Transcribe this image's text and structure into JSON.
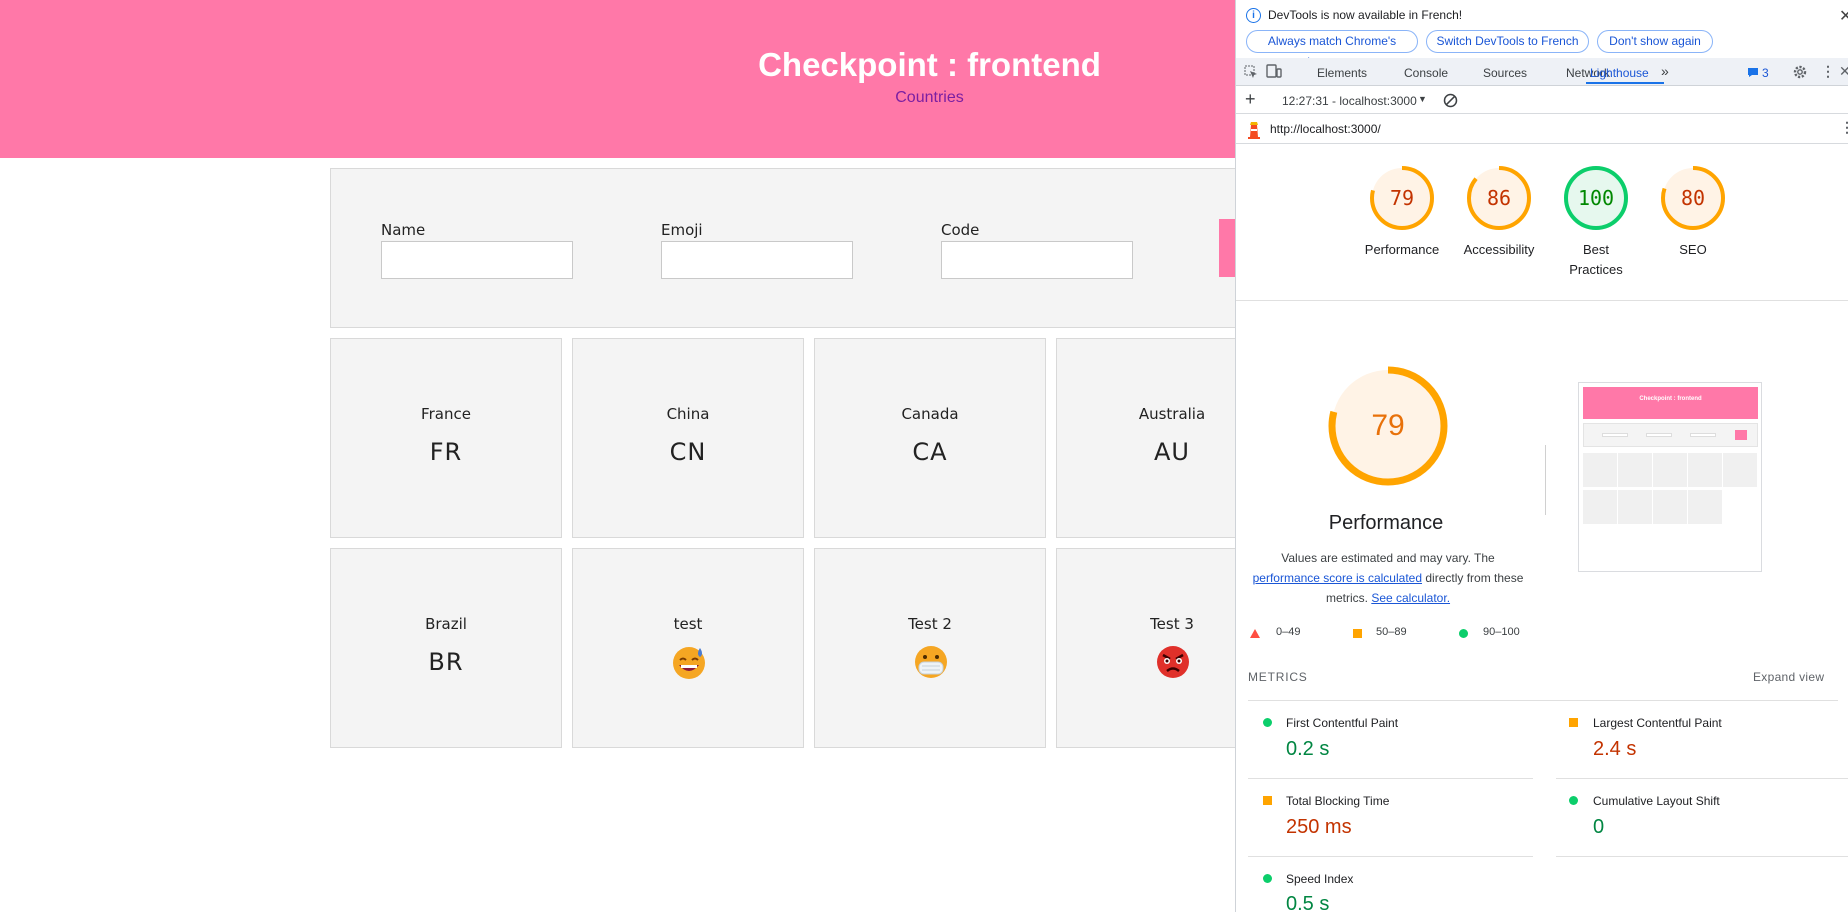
{
  "app": {
    "title": "Checkpoint : frontend",
    "nav_link": "Countries",
    "form": {
      "name_label": "Name",
      "emoji_label": "Emoji",
      "code_label": "Code",
      "name_value": "",
      "emoji_value": "",
      "code_value": ""
    },
    "cards": [
      {
        "name": "France",
        "code": "FR"
      },
      {
        "name": "China",
        "code": "CN"
      },
      {
        "name": "Canada",
        "code": "CA"
      },
      {
        "name": "Australia",
        "code": "AU"
      },
      {
        "name": "Brazil",
        "code": "BR"
      },
      {
        "name": "test",
        "emoji": "grinning-sweat-emoji"
      },
      {
        "name": "Test 2",
        "emoji": "face-with-mask-emoji"
      },
      {
        "name": "Test 3",
        "emoji": "angry-face-emoji"
      }
    ],
    "colors": {
      "header": "#ff78a8",
      "card": "#f4f4f4"
    }
  },
  "devtools": {
    "infobar": {
      "message": "DevTools is now available in French!",
      "buttons": [
        "Always match Chrome's language",
        "Switch DevTools to French",
        "Don't show again"
      ]
    },
    "tabs": [
      "Elements",
      "Console",
      "Sources",
      "Network",
      "Lighthouse"
    ],
    "active_tab": "Lighthouse",
    "issues_count": "3",
    "report_selector": "12:27:31 - localhost:3000",
    "url": "http://localhost:3000/",
    "scores": [
      {
        "label": "Performance",
        "value": 79,
        "color": "#e8710a"
      },
      {
        "label": "Accessibility",
        "value": 86,
        "color": "#e8710a"
      },
      {
        "label": "Best Practices",
        "value": 100,
        "color": "#0cce6b"
      },
      {
        "label": "SEO",
        "value": 80,
        "color": "#e8710a"
      }
    ],
    "performance": {
      "score": 79,
      "title": "Performance",
      "desc_1": "Values are estimated and may vary. The",
      "desc_link_1": "performance score is calculated",
      "desc_2": "directly from these metrics.",
      "desc_link_2": "See calculator."
    },
    "legend": [
      "0–49",
      "50–89",
      "90–100"
    ],
    "metrics_header": "METRICS",
    "expand_view": "Expand view",
    "metrics": [
      {
        "title": "First Contentful Paint",
        "value": "0.2 s",
        "status": "pass"
      },
      {
        "title": "Largest Contentful Paint",
        "value": "2.4 s",
        "status": "average"
      },
      {
        "title": "Total Blocking Time",
        "value": "250 ms",
        "status": "average"
      },
      {
        "title": "Cumulative Layout Shift",
        "value": "0",
        "status": "pass"
      },
      {
        "title": "Speed Index",
        "value": "0.5 s",
        "status": "pass"
      }
    ],
    "thumbnail_title": "Checkpoint : frontend"
  }
}
